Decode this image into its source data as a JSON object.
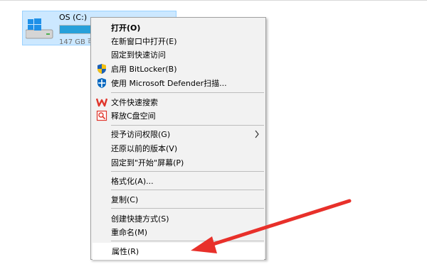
{
  "drive": {
    "name": "OS (C:)",
    "size_text": "147 GB 可",
    "used_fraction": 0.6,
    "bar_color": "#26a0da"
  },
  "menu": {
    "items": [
      {
        "label": "打开(O)",
        "bold": true,
        "icon": null
      },
      {
        "label": "在新窗口中打开(E)",
        "icon": null
      },
      {
        "label": "固定到快速访问",
        "icon": null
      },
      {
        "label": "启用 BitLocker(B)",
        "icon": "uac-shield-icon"
      },
      {
        "label": "使用 Microsoft Defender扫描...",
        "icon": "defender-shield-icon"
      },
      {
        "label": "文件快速搜索",
        "icon": "wps-icon"
      },
      {
        "label": "释放C盘空间",
        "icon": "cleanup-icon"
      },
      {
        "label": "授予访问权限(G)",
        "icon": null,
        "submenu": true
      },
      {
        "label": "还原以前的版本(V)",
        "icon": null
      },
      {
        "label": "固定到\"开始\"屏幕(P)",
        "icon": null
      },
      {
        "label": "格式化(A)...",
        "icon": null
      },
      {
        "label": "复制(C)",
        "icon": null
      },
      {
        "label": "创建快捷方式(S)",
        "icon": null
      },
      {
        "label": "重命名(M)",
        "icon": null
      },
      {
        "label": "属性(R)",
        "icon": null
      }
    ]
  },
  "colors": {
    "selection_bg": "#cce8ff",
    "menu_bg": "#f2f2f2",
    "arrow": "#e8302a"
  }
}
